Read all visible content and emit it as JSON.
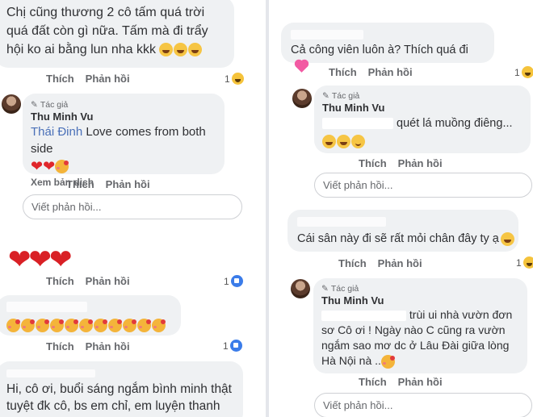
{
  "left": {
    "c1": {
      "text": "Chị cũng thương 2 cô tấm quá trời quá đất còn gì nữa. Tấm mà đi trẩy hội ko ai bằng lun nha kkk",
      "actions": [
        "Thích",
        "Phản hồi"
      ],
      "reaction_count": "1",
      "reaction_icon": "haha-icon"
    },
    "r1": {
      "badge": "Tác giả",
      "author": "Thu Minh Vu",
      "mention": "Thái Đinh",
      "text": " Love comes from both side",
      "translate": "Xem bản dịch",
      "actions": [
        "Thích",
        "Phản hồi"
      ]
    },
    "reply_placeholder": "Viết phản hồi...",
    "c2": {
      "actions": [
        "Thích",
        "Phản hồi"
      ],
      "reaction_count": "1",
      "reaction_icon": "like-icon"
    },
    "c3": {
      "actions": [
        "Thích",
        "Phản hồi"
      ],
      "reaction_count": "1",
      "reaction_icon": "like-icon"
    },
    "c4": {
      "text": "Hi, cô ơi, buổi sáng ngắm bình minh thật tuyệt đk cô, bs em chỉ, em luyện thanh cô ơi"
    }
  },
  "right": {
    "c1": {
      "text": "Cả công viên luôn à? Thích quá đi",
      "actions": [
        "Thích",
        "Phản hồi"
      ],
      "reaction_count": "1",
      "reaction_icon": "haha-icon"
    },
    "r1": {
      "badge": "Tác giả",
      "author": "Thu Minh Vu",
      "text": "quét lá muồng điêng...",
      "actions": [
        "Thích",
        "Phản hồi"
      ]
    },
    "reply_placeholder": "Viết phản hồi...",
    "c2": {
      "text": "Cái sân này đi sẽ rất mỏi chân đây ty ạ",
      "actions": [
        "Thích",
        "Phản hồi"
      ],
      "reaction_count": "1",
      "reaction_icon": "haha-icon"
    },
    "r2": {
      "badge": "Tác giả",
      "author": "Thu Minh Vu",
      "text_line1": "trùi ui nhà vườn đơn",
      "text_rest": "sơ Cô ơi ! Ngày nào C cũng ra vườn ngắm sao mơ dc ở Lâu Đài giữa lòng Hà Nội nà ..",
      "actions": [
        "Thích",
        "Phản hồi"
      ]
    },
    "reply_placeholder_2": "Viết phản hồi..."
  }
}
